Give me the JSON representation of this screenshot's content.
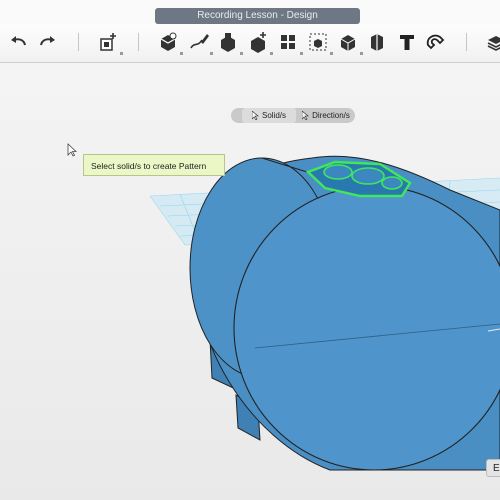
{
  "window": {
    "title": "Recording Lesson - Design"
  },
  "toolbar": {
    "buttons": [
      {
        "name": "undo-icon"
      },
      {
        "name": "redo-icon"
      },
      {
        "name": "new-solid-icon"
      },
      {
        "name": "primitives-icon"
      },
      {
        "name": "sketch-icon"
      },
      {
        "name": "construct-icon"
      },
      {
        "name": "modify-icon"
      },
      {
        "name": "pattern-icon"
      },
      {
        "name": "group-icon"
      },
      {
        "name": "combine-icon"
      },
      {
        "name": "measure-icon"
      },
      {
        "name": "text-icon"
      },
      {
        "name": "snap-icon"
      },
      {
        "name": "material-icon"
      }
    ]
  },
  "viewport": {
    "selector": {
      "solids_label": "Solid/s",
      "directions_label": "Direction/s",
      "active": "Solid/s"
    },
    "tooltip": "Select solid/s to create Pattern",
    "edge_button_label": "E"
  },
  "colors": {
    "solid_fill": "#4a8fc4",
    "solid_top": "#5a9ed1",
    "grid": "#8fd2ec",
    "highlight": "#3ee85a",
    "tooltip_bg": "#ecf7c8"
  }
}
